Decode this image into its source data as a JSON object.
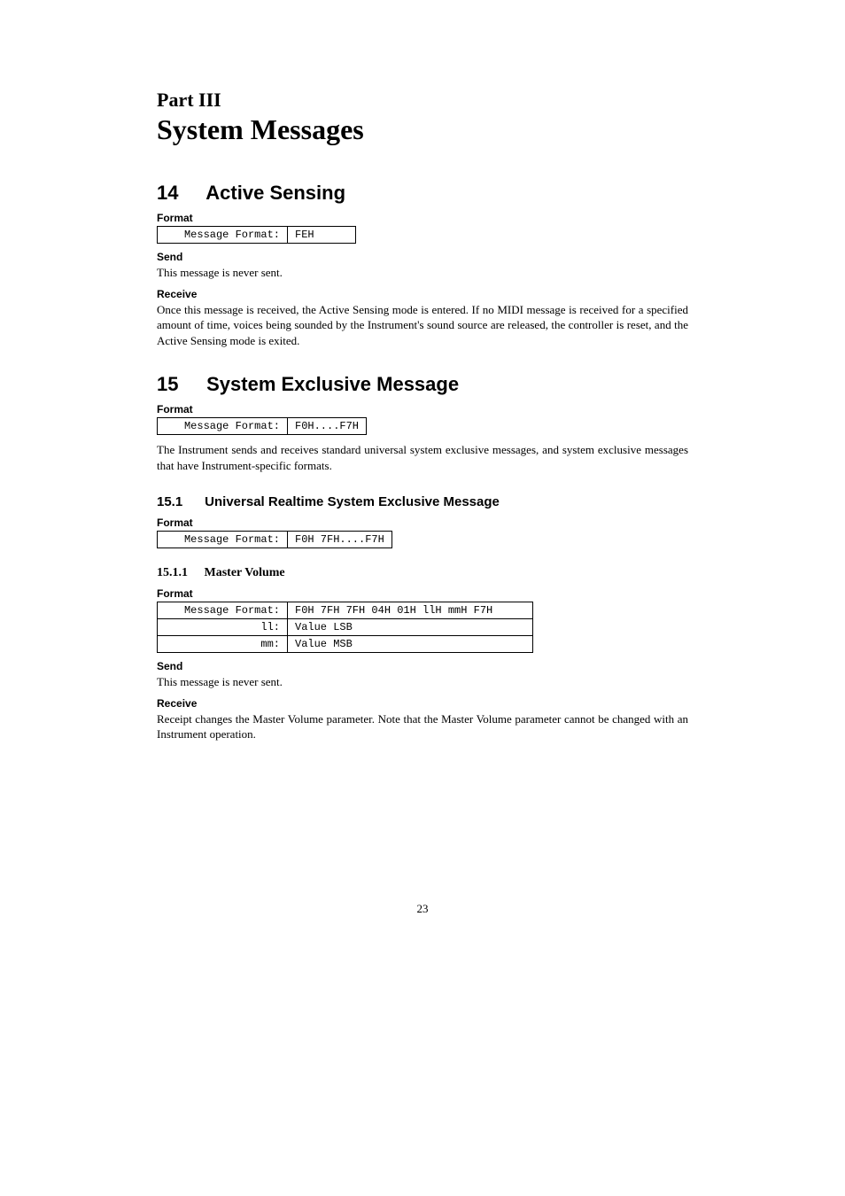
{
  "part": {
    "label": "Part III",
    "title": "System Messages"
  },
  "sec14": {
    "num": "14",
    "title": "Active Sensing",
    "format_label": "Format",
    "table": {
      "key": "Message Format:",
      "val": "FEH"
    },
    "send_label": "Send",
    "send_text": "This message is never sent.",
    "receive_label": "Receive",
    "receive_text": "Once this message is received, the Active Sensing mode is entered. If no MIDI message is received for a specified amount of time, voices being sounded by the Instrument's sound source are released, the controller is reset, and the Active Sensing mode is exited."
  },
  "sec15": {
    "num": "15",
    "title": "System Exclusive Message",
    "format_label": "Format",
    "table": {
      "key": "Message Format:",
      "val": "F0H....F7H"
    },
    "intro_text": "The Instrument sends and receives standard universal system exclusive messages, and system exclusive messages that have Instrument-specific formats."
  },
  "sec15_1": {
    "num": "15.1",
    "title": "Universal Realtime System Exclusive Message",
    "format_label": "Format",
    "table": {
      "key": "Message Format:",
      "val": "F0H 7FH....F7H"
    }
  },
  "sec15_1_1": {
    "num": "15.1.1",
    "title": "Master Volume",
    "format_label": "Format",
    "rows": [
      {
        "key": "Message Format:",
        "val": "F0H 7FH 7FH 04H 01H llH mmH F7H"
      },
      {
        "key": "ll:",
        "val": "Value LSB"
      },
      {
        "key": "mm:",
        "val": "Value MSB"
      }
    ],
    "send_label": "Send",
    "send_text": "This message is never sent.",
    "receive_label": "Receive",
    "receive_text": "Receipt changes the Master Volume parameter. Note that the Master Volume parameter cannot be changed with an Instrument operation."
  },
  "page_number": "23"
}
